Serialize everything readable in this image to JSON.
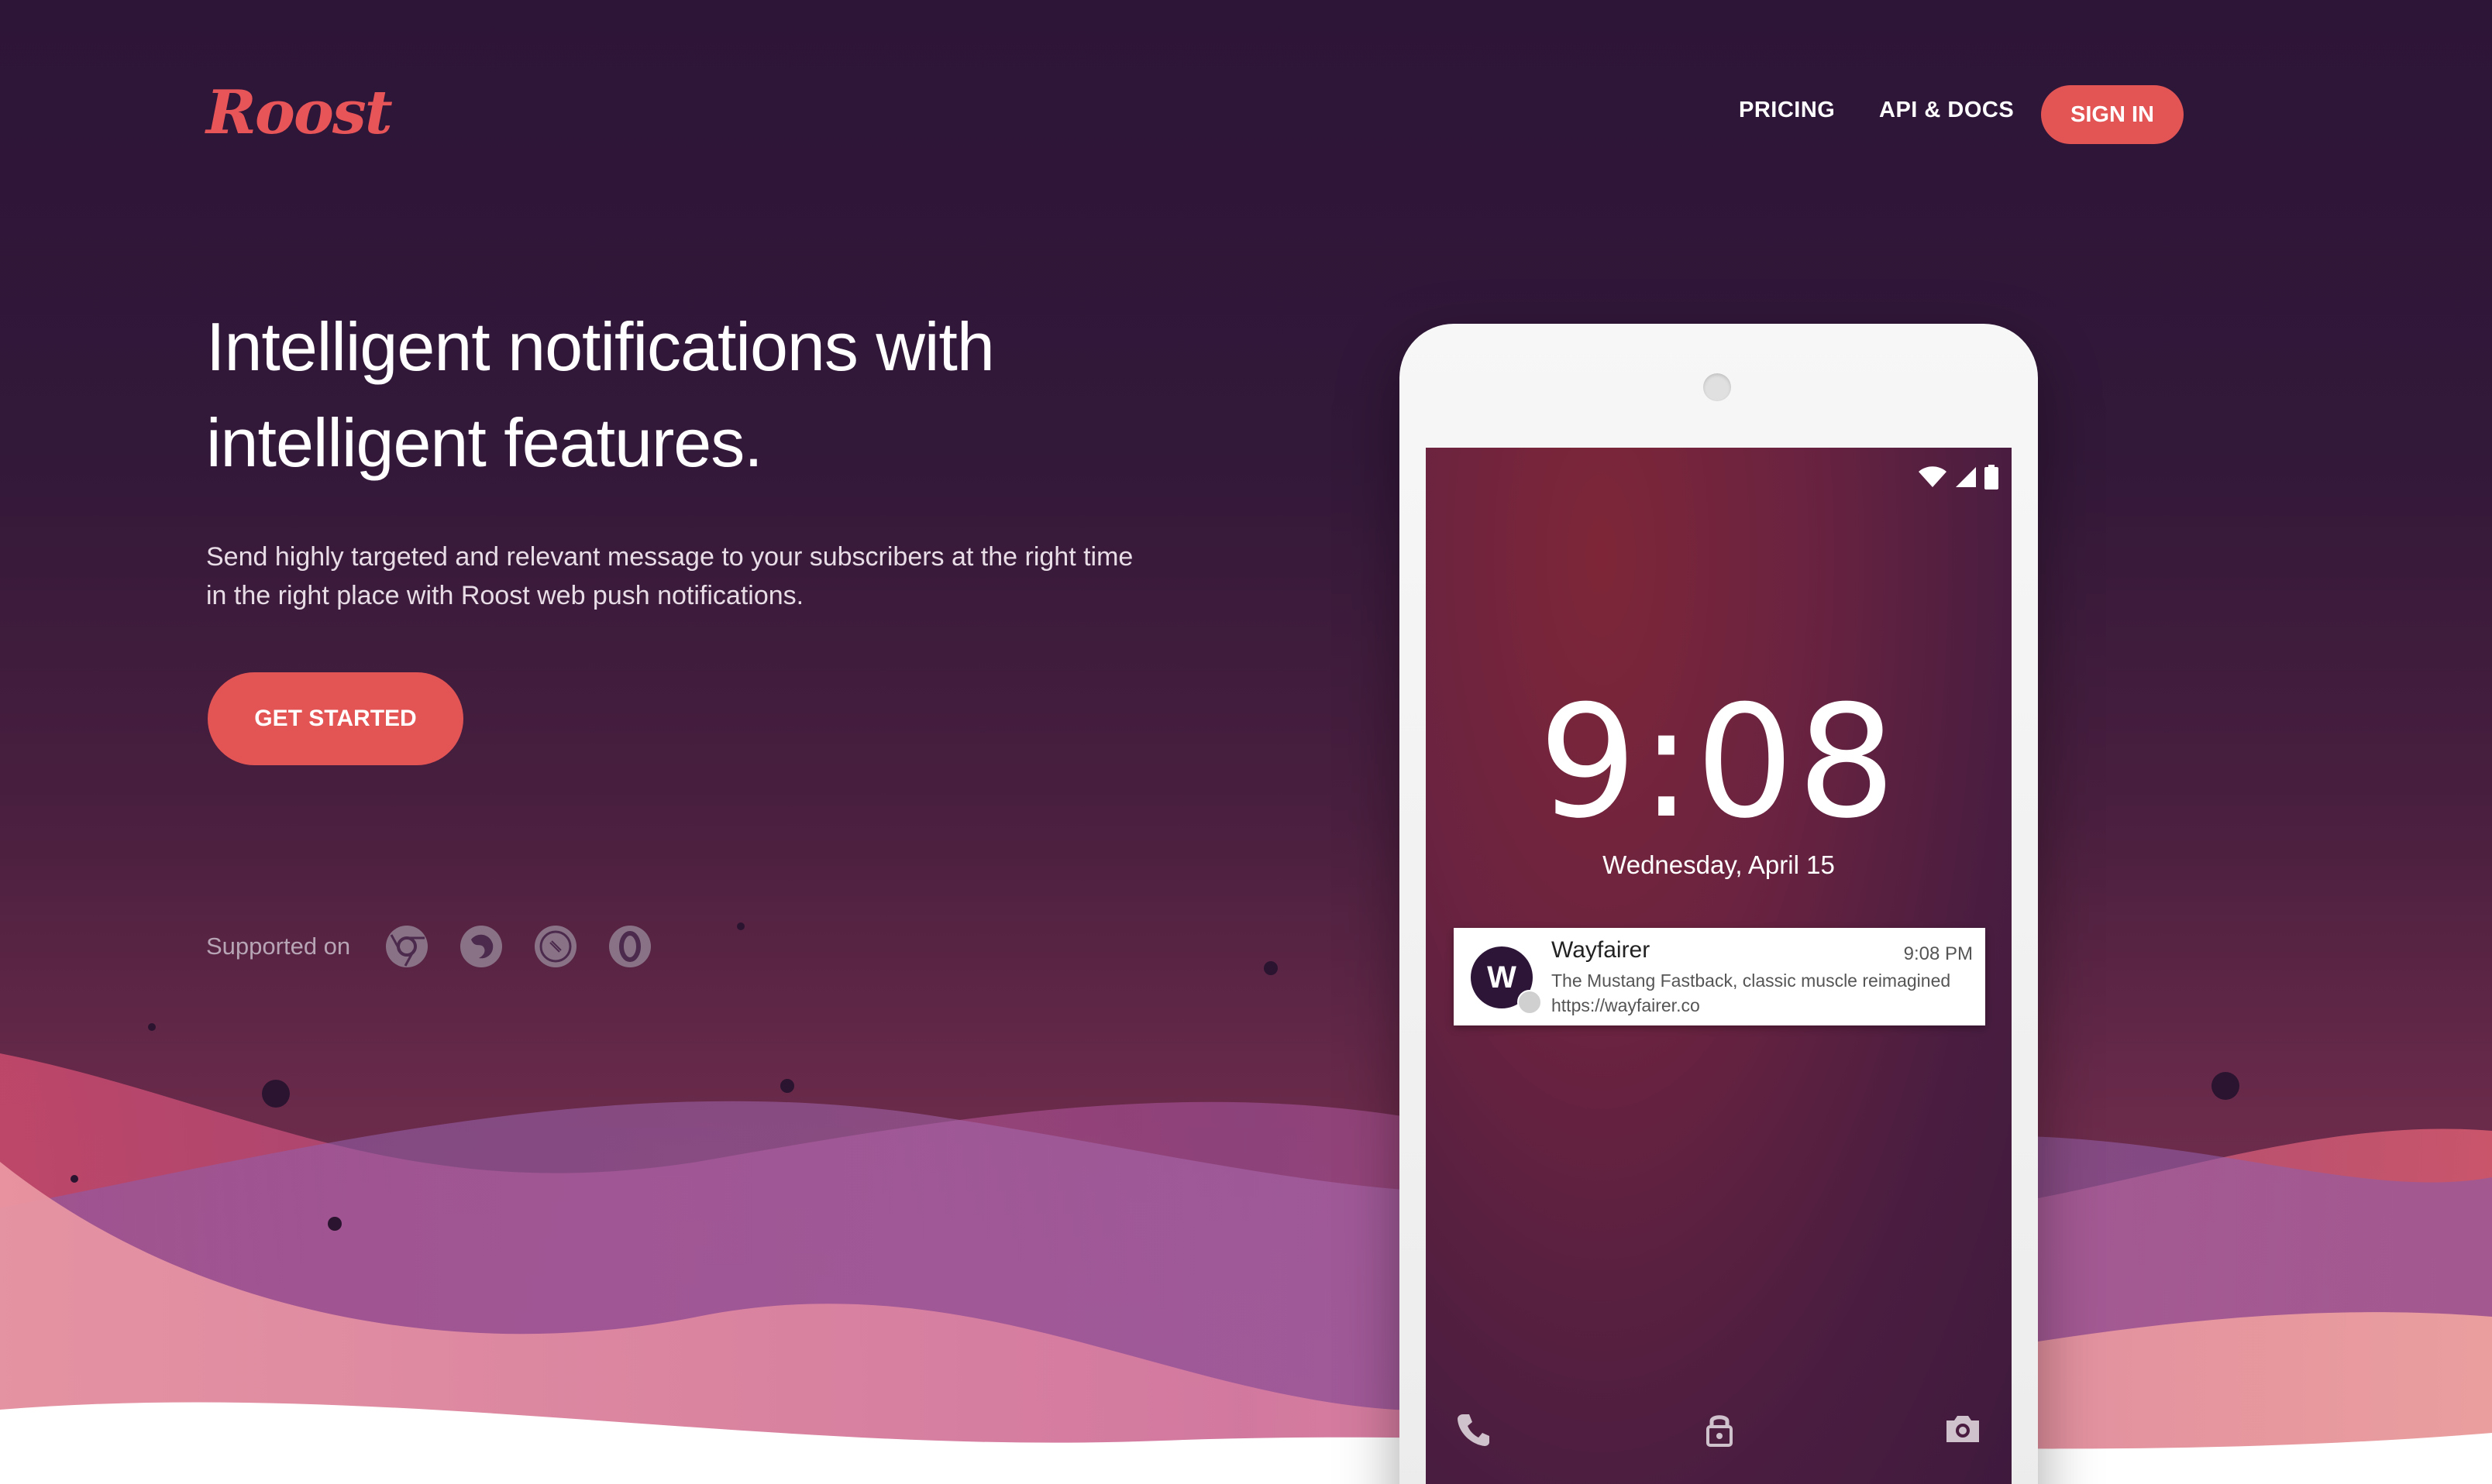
{
  "header": {
    "logo_text": "Roost",
    "nav": {
      "pricing_label": "PRICING",
      "api_docs_label": "API & DOCS",
      "signin_label": "SIGN IN"
    }
  },
  "hero": {
    "title": "Intelligent notifications with intelligent features.",
    "subtitle": "Send highly targeted and relevant message to your subscribers at the right time in the right place with Roost web push notifications.",
    "cta_label": "GET STARTED",
    "supported_label": "Supported on",
    "browsers": [
      "chrome-icon",
      "firefox-icon",
      "safari-icon",
      "opera-icon"
    ]
  },
  "phone": {
    "time": "9:08",
    "date": "Wednesday, April 15",
    "notification": {
      "avatar_letter": "W",
      "title": "Wayfairer",
      "time": "9:08 PM",
      "body": "The Mustang Fastback, classic muscle reimagined",
      "url": "https://wayfairer.co"
    }
  },
  "colors": {
    "accent": "#e35455",
    "background_top": "#2d1538",
    "background_bottom": "#7a3354"
  }
}
